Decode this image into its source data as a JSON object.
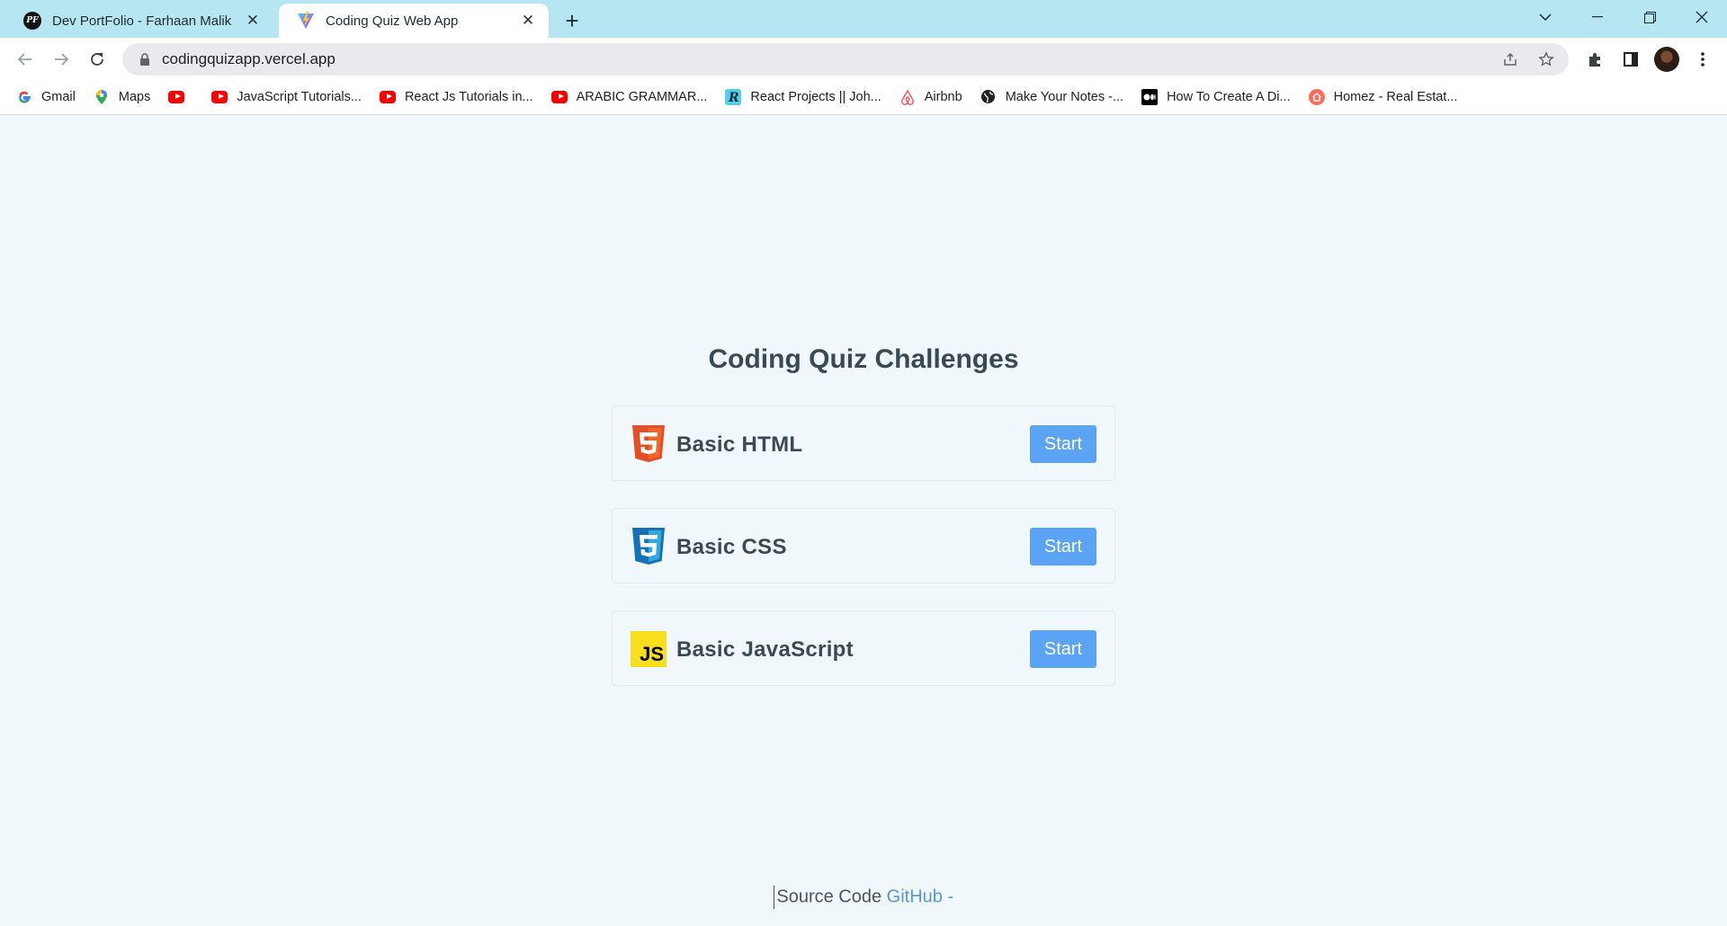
{
  "browser": {
    "tabs": [
      {
        "title": "Dev PortFolio - Farhaan Malik",
        "favicon": "PF",
        "active": false
      },
      {
        "title": "Coding Quiz Web App",
        "favicon": "vite-icon",
        "active": true
      }
    ],
    "url": "codingquizapp.vercel.app",
    "bookmarks": [
      {
        "label": "Gmail",
        "icon": "google-icon"
      },
      {
        "label": "Maps",
        "icon": "maps-icon"
      },
      {
        "label": "",
        "icon": "youtube-icon"
      },
      {
        "label": "JavaScript Tutorials...",
        "icon": "youtube-icon"
      },
      {
        "label": "React Js Tutorials in...",
        "icon": "youtube-icon"
      },
      {
        "label": "ARABIC GRAMMAR...",
        "icon": "youtube-icon"
      },
      {
        "label": "React Projects || Joh...",
        "icon": "r-icon"
      },
      {
        "label": "Airbnb",
        "icon": "airbnb-icon"
      },
      {
        "label": "Make Your Notes -...",
        "icon": "globe-icon"
      },
      {
        "label": "How To Create A Di...",
        "icon": "medium-icon"
      },
      {
        "label": "Homez - Real Estat...",
        "icon": "home-icon"
      }
    ]
  },
  "quiz": {
    "heading": "Coding Quiz Challenges",
    "items": [
      {
        "name": "Basic HTML",
        "icon": "html5-icon",
        "button": "Start"
      },
      {
        "name": "Basic CSS",
        "icon": "css3-icon",
        "button": "Start"
      },
      {
        "name": "Basic JavaScript",
        "icon": "js-icon",
        "button": "Start",
        "badge": "JS"
      }
    ]
  },
  "footer": {
    "prefix": "Source Code ",
    "link": "GitHub",
    "suffix": " -"
  },
  "colors": {
    "accent": "#5aa3f5",
    "background": "#f0f8fc",
    "tabstrip": "#b7e6f3"
  }
}
